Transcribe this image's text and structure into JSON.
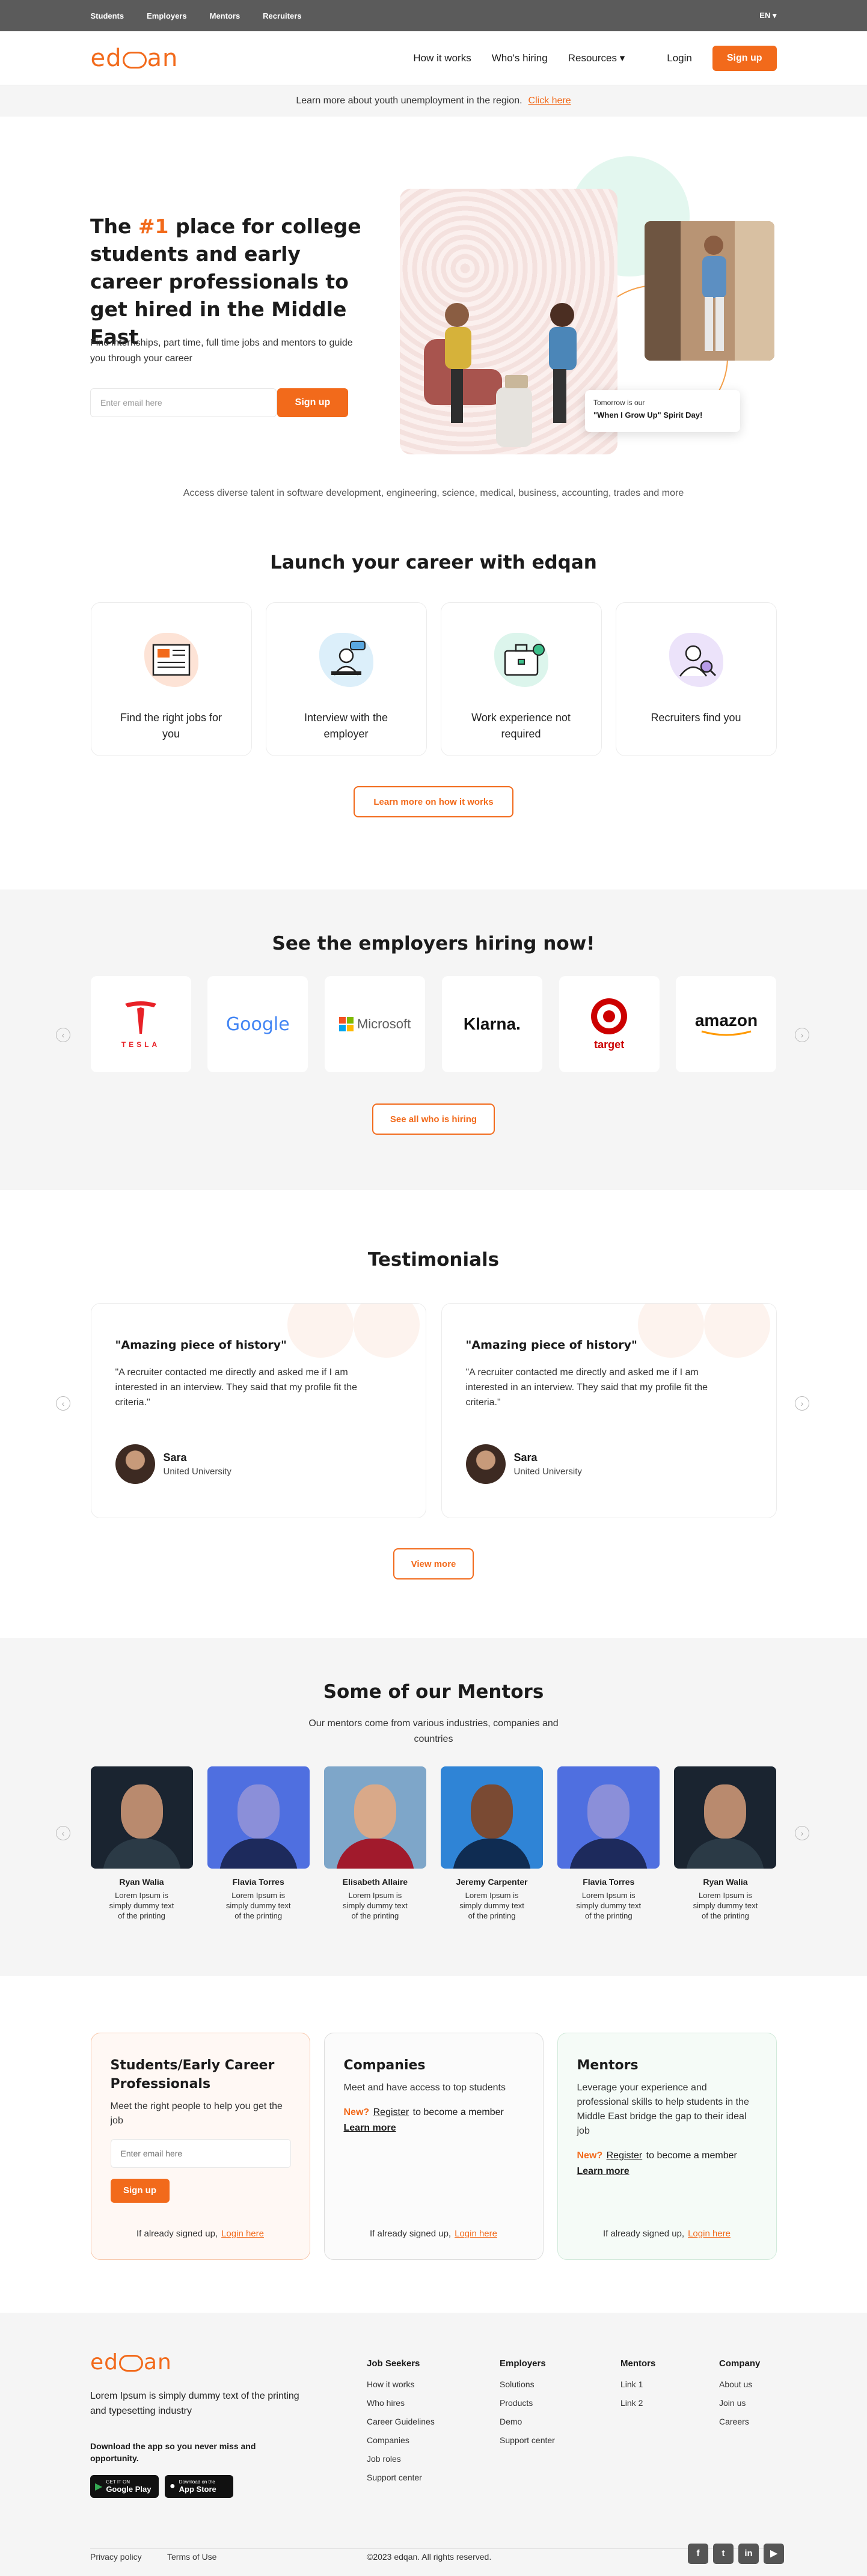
{
  "topbar": {
    "links": [
      "Students",
      "Employers",
      "Mentors",
      "Recruiters"
    ],
    "language": "EN ▾"
  },
  "nav": {
    "logo": "edqan",
    "links": [
      "How it works",
      "Who's hiring",
      "Resources ▾"
    ],
    "login": "Login",
    "signup": "Sign up"
  },
  "banner": {
    "text": "Learn more about youth unemployment in the region.",
    "link": "Click here"
  },
  "hero": {
    "title_pre": "The ",
    "title_highlight": "#1",
    "title_post": " place for college students and early career professionals to get hired in the Middle East",
    "subtitle": "Find internships, part time, full time jobs and mentors to guide you through your career",
    "email_placeholder": "Enter email here",
    "signup": "Sign up",
    "card_line1": "Tomorrow is our",
    "card_line2": "\"When I Grow Up\" Spirit Day!",
    "talent": "Access diverse talent in software development, engineering, science, medical, business, accounting, trades and more"
  },
  "launch": {
    "title": "Launch your career with edqan",
    "cards": [
      {
        "label": "Find the right jobs for you",
        "icon": "newspaper-icon",
        "color": "#fde3d6"
      },
      {
        "label": "Interview with the employer",
        "icon": "interview-icon",
        "color": "#dceffa"
      },
      {
        "label": "Work experience not required",
        "icon": "briefcase-icon",
        "color": "#dcf5ec"
      },
      {
        "label": "Recruiters find you",
        "icon": "recruiter-search-icon",
        "color": "#ece3fa"
      }
    ],
    "button": "Learn more on how it works"
  },
  "employers": {
    "title": "See the employers hiring now!",
    "logos": [
      "TESLA",
      "Google",
      "Microsoft",
      "Klarna.",
      "target",
      "amazon"
    ],
    "button": "See all who is hiring"
  },
  "testimonials": {
    "title": "Testimonials",
    "items": [
      {
        "headline": "\"Amazing piece of history\"",
        "quote": "\"A recruiter contacted me directly and asked me if I am interested in an interview. They said that my profile fit the criteria.\"",
        "name": "Sara",
        "university": "United University"
      },
      {
        "headline": "\"Amazing piece of history\"",
        "quote": "\"A recruiter contacted me directly and asked me if I am interested in an interview. They said that my profile fit the criteria.\"",
        "name": "Sara",
        "university": "United University"
      }
    ],
    "button": "View more"
  },
  "mentors": {
    "title": "Some of our Mentors",
    "subtitle": "Our mentors come from various industries, companies and countries",
    "items": [
      {
        "name": "Ryan Walia",
        "desc": "Lorem Ipsum is simply dummy text of the printing",
        "bg": "#1a2430",
        "skin": "#b98a6e",
        "shirt": "#2b3a46"
      },
      {
        "name": "Flavia Torres",
        "desc": "Lorem Ipsum is simply dummy text of the printing",
        "bg": "#4f6fe0",
        "skin": "#8b8fd9",
        "shirt": "#1d2a5c"
      },
      {
        "name": "Elisabeth Allaire",
        "desc": "Lorem Ipsum is simply dummy text of the printing",
        "bg": "#7ea6c9",
        "skin": "#d9a989",
        "shirt": "#a11a2c"
      },
      {
        "name": "Jeremy Carpenter",
        "desc": "Lorem Ipsum is simply dummy text of the printing",
        "bg": "#2f84d6",
        "skin": "#7a4a33",
        "shirt": "#0f2c52"
      },
      {
        "name": "Flavia Torres",
        "desc": "Lorem Ipsum is simply dummy text of the printing",
        "bg": "#4f6fe0",
        "skin": "#8b8fd9",
        "shirt": "#1d2a5c"
      },
      {
        "name": "Ryan Walia",
        "desc": "Lorem Ipsum is simply dummy text of the printing",
        "bg": "#1a2430",
        "skin": "#b98a6e",
        "shirt": "#2b3a46"
      }
    ]
  },
  "join": {
    "students": {
      "title": "Students/Early Career Professionals",
      "desc": "Meet the right people to help you get the job",
      "email_placeholder": "Enter email here",
      "signup": "Sign up",
      "already": "If already signed up,",
      "login": "Login here",
      "bg": "#fff8f4",
      "border": "#f8c9ae"
    },
    "companies": {
      "title": "Companies",
      "desc": "Meet and have access to top students",
      "new": "New?",
      "register": "Register",
      "register_rest": "to become a member",
      "learn": "Learn more",
      "already": "If already signed up,",
      "login": "Login here",
      "bg": "#fbfbfb",
      "border": "#dddddd"
    },
    "mentors": {
      "title": "Mentors",
      "desc": "Leverage your experience and professional skills to help students in the Middle East bridge the gap to their ideal job",
      "new": "New?",
      "register": "Register",
      "register_rest": "to become a member",
      "learn": "Learn more",
      "already": "If already signed up,",
      "login": "Login here",
      "bg": "#f5fbf7",
      "border": "#d2eadb"
    }
  },
  "footer": {
    "logo": "edqan",
    "text": "Lorem Ipsum is simply dummy text of the printing and typesetting industry",
    "download": "Download the app so you never miss and opportunity.",
    "google_small": "GET IT ON",
    "google_big": "Google Play",
    "apple_small": "Download on the",
    "apple_big": "App Store",
    "columns": [
      {
        "title": "Job Seekers",
        "links": [
          "How it works",
          "Who hires",
          "Career Guidelines",
          "Companies",
          "Job roles",
          "Support center"
        ]
      },
      {
        "title": "Employers",
        "links": [
          "Solutions",
          "Products",
          "Demo",
          "Support center"
        ]
      },
      {
        "title": "Mentors",
        "links": [
          "Link 1",
          "Link 2"
        ]
      },
      {
        "title": "Company",
        "links": [
          "About us",
          "Join us",
          "Careers"
        ]
      }
    ],
    "privacy": "Privacy policy",
    "terms": "Terms of Use",
    "copyright": "©2023 edqan. All rights reserved.",
    "social": [
      "f",
      "t",
      "in",
      "▶"
    ]
  },
  "colors": {
    "accent": "#f26a1b",
    "topbar": "#5b5b5b",
    "section_bg": "#f5f5f5"
  }
}
